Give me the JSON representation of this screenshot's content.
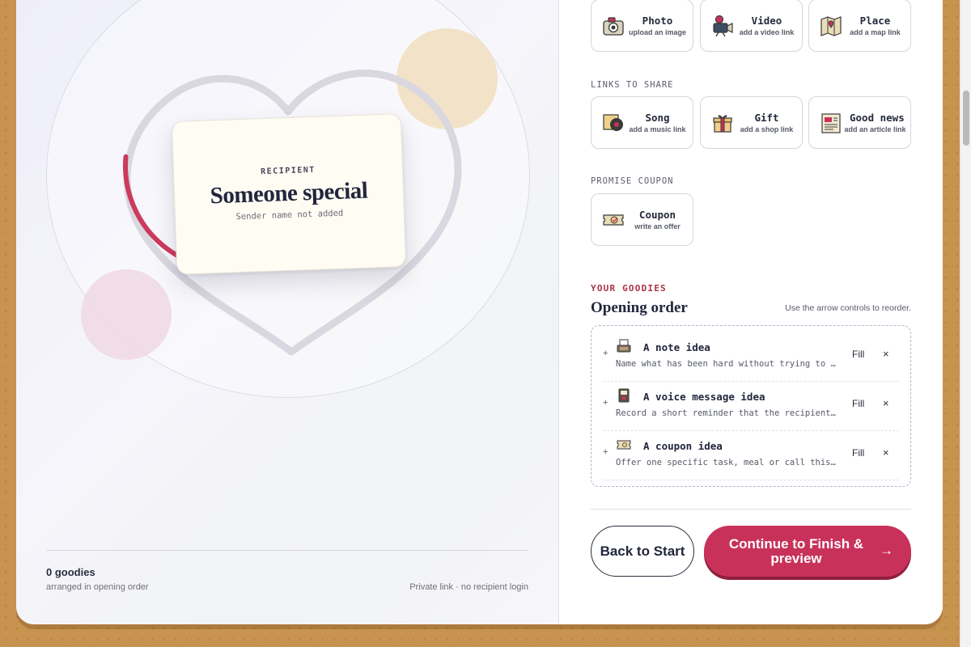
{
  "preview": {
    "card_eyebrow": "RECIPIENT",
    "recipient_name": "Someone special",
    "sender": "Sender name not added",
    "progress_fraction": 0.33
  },
  "left_footer": {
    "count": "0 goodies",
    "count_sub": "arranged in opening order",
    "privacy": "Private link · no recipient login"
  },
  "media_tiles": [
    {
      "title": "Photo",
      "sub": "upload an image",
      "icon": "camera-icon"
    },
    {
      "title": "Video",
      "sub": "add a video link",
      "icon": "video-camera-icon"
    },
    {
      "title": "Place",
      "sub": "add a map link",
      "icon": "map-icon"
    }
  ],
  "links_section": {
    "label": "LINKS TO SHARE",
    "tiles": [
      {
        "title": "Song",
        "sub": "add a music link",
        "icon": "record-icon"
      },
      {
        "title": "Gift",
        "sub": "add a shop link",
        "icon": "gift-icon"
      },
      {
        "title": "Good news",
        "sub": "add an article link",
        "icon": "newspaper-icon"
      }
    ]
  },
  "coupon_section": {
    "label": "PROMISE COUPON",
    "tiles": [
      {
        "title": "Coupon",
        "sub": "write an offer",
        "icon": "ticket-icon"
      }
    ]
  },
  "goodies": {
    "eyebrow": "YOUR GOODIES",
    "title": "Opening order",
    "hint": "Use the arrow controls to reorder.",
    "items": [
      {
        "plus": "+",
        "title": "A note idea",
        "desc": "Name what has been hard without trying to fix it.",
        "fill": "Fill",
        "remove": "×",
        "icon": "typewriter-icon"
      },
      {
        "plus": "+",
        "title": "A voice message idea",
        "desc": "Record a short reminder that the recipient is loved.",
        "fill": "Fill",
        "remove": "×",
        "icon": "recorder-icon"
      },
      {
        "plus": "+",
        "title": "A coupon idea",
        "desc": "Offer one specific task, meal or call this week.",
        "fill": "Fill",
        "remove": "×",
        "icon": "ticket-icon"
      }
    ]
  },
  "actions": {
    "back": "Back to Start",
    "continue": "Continue to Finish & preview",
    "continue_arrow": "→"
  },
  "colors": {
    "accent": "#c8325a",
    "eyebrow": "#a83445",
    "page_bg": "#c8924f",
    "ink": "#22263c"
  }
}
